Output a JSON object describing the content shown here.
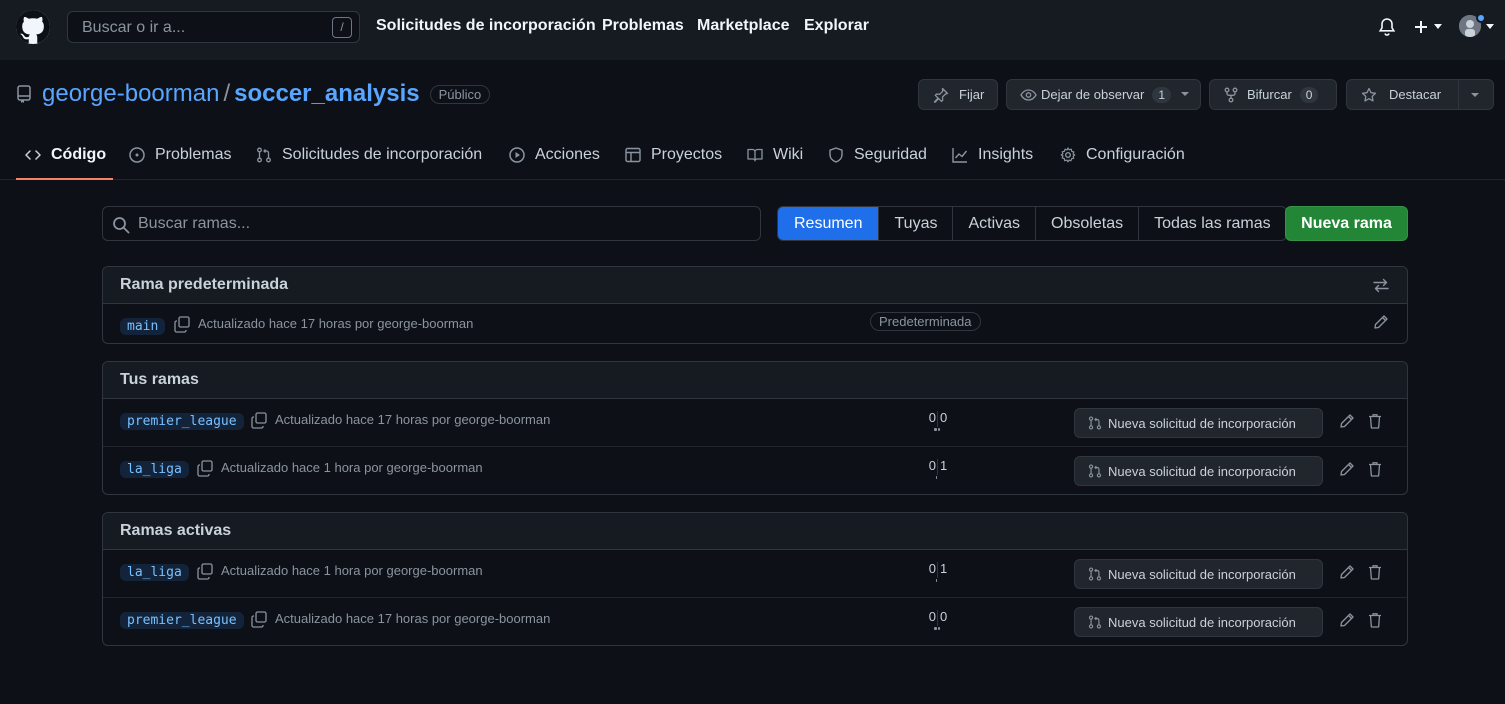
{
  "header": {
    "search_placeholder": "Buscar o ir a...",
    "search_shortcut": "/",
    "nav": [
      "Solicitudes de incorporación",
      "Problemas",
      "Marketplace",
      "Explorar"
    ],
    "icons": [
      "github-logo-icon",
      "bell-icon",
      "plus-icon",
      "avatar"
    ]
  },
  "repo": {
    "owner": "george-boorman",
    "separator": "/",
    "name": "soccer_analysis",
    "visibility": "Público",
    "actions": {
      "pin": "Fijar",
      "watch": "Dejar de observar",
      "watch_count": "1",
      "fork": "Bifurcar",
      "fork_count": "0",
      "star": "Destacar"
    }
  },
  "tabs": [
    "Código",
    "Problemas",
    "Solicitudes de incorporación",
    "Acciones",
    "Proyectos",
    "Wiki",
    "Seguridad",
    "Insights",
    "Configuración"
  ],
  "branches": {
    "search_placeholder": "Buscar ramas...",
    "filters": [
      "Resumen",
      "Tuyas",
      "Activas",
      "Obsoletas",
      "Todas las ramas"
    ],
    "active_filter": "Resumen",
    "new_branch": "Nueva rama",
    "pr_label": "Nueva solicitud de incorporación",
    "default_section": {
      "title": "Rama predeterminada",
      "name": "main",
      "updated": "Actualizado hace 17 horas por george-boorman",
      "badge": "Predeterminada"
    },
    "yours_section": {
      "title": "Tus ramas",
      "rows": [
        {
          "name": "premier_league",
          "updated": "Actualizado hace 17 horas por george-boorman",
          "behind": "0",
          "ahead": "0"
        },
        {
          "name": "la_liga",
          "updated": "Actualizado hace 1 hora por george-boorman",
          "behind": "0",
          "ahead": "1"
        }
      ]
    },
    "active_section": {
      "title": "Ramas activas",
      "rows": [
        {
          "name": "la_liga",
          "updated": "Actualizado hace 1 hora por george-boorman",
          "behind": "0",
          "ahead": "1"
        },
        {
          "name": "premier_league",
          "updated": "Actualizado hace 17 horas por george-boorman",
          "behind": "0",
          "ahead": "0"
        }
      ]
    }
  }
}
